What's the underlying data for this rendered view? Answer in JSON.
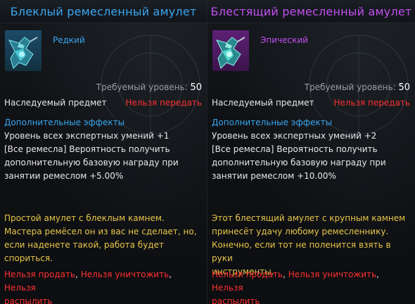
{
  "left": {
    "title": "Блеклый ремесленный амулет",
    "grade": "Редкий",
    "req_label": "Требуемый уровень:",
    "req_value": "50",
    "inherited": "Наследуемый предмет",
    "no_transfer": "Нельзя передать",
    "effects_header": "Дополнительные эффекты",
    "effect_1": "Уровень всех экспертных умений +1",
    "effect_2_line1": "[Все ремесла] Вероятность получить",
    "effect_2_line2": "дополнительную базовую награду при",
    "effect_2_line3": "занятии ремеслом +5.00%",
    "desc_line1": "Простой амулет с блеклым камнем.",
    "desc_line2": "Мастера ремёсел он из вас не сделает, но,",
    "desc_line3": "если наденете такой, работа будет",
    "desc_line4": "спориться.",
    "restr_sell": "Нельзя продать",
    "restr_destroy": "Нельзя уничтожить",
    "restr_dismantle_1": "Нельзя",
    "restr_dismantle_2": "распылить",
    "comma": ","
  },
  "right": {
    "title": "Блестящий ремесленный амулет",
    "grade": "Эпический",
    "req_label": "Требуемый уровень:",
    "req_value": "50",
    "inherited": "Наследуемый предмет",
    "no_transfer": "Нельзя передать",
    "effects_header": "Дополнительные эффекты",
    "effect_1": "Уровень всех экспертных умений +2",
    "effect_2_line1": "[Все ремесла] Вероятность получить",
    "effect_2_line2": "дополнительную базовую награду при",
    "effect_2_line3": "занятии ремеслом +10.00%",
    "desc_line1": "Этот блестящий амулет с крупным камнем",
    "desc_line2": "принесёт удачу любому ремесленнику.",
    "desc_line3": "Конечно, если тот не поленится взять в руки",
    "desc_line4": "инструменты.",
    "restr_sell": "Нельзя продать",
    "restr_destroy": "Нельзя уничтожить",
    "restr_dismantle_1": "Нельзя",
    "restr_dismantle_2": "распылить",
    "comma": ","
  },
  "colors": {
    "rare": "#3aa6ef",
    "epic": "#c24ef0",
    "warning": "#ff3030",
    "description": "#e8c64a"
  },
  "icons": {
    "left_item": "amulet-icon",
    "right_item": "amulet-icon"
  }
}
